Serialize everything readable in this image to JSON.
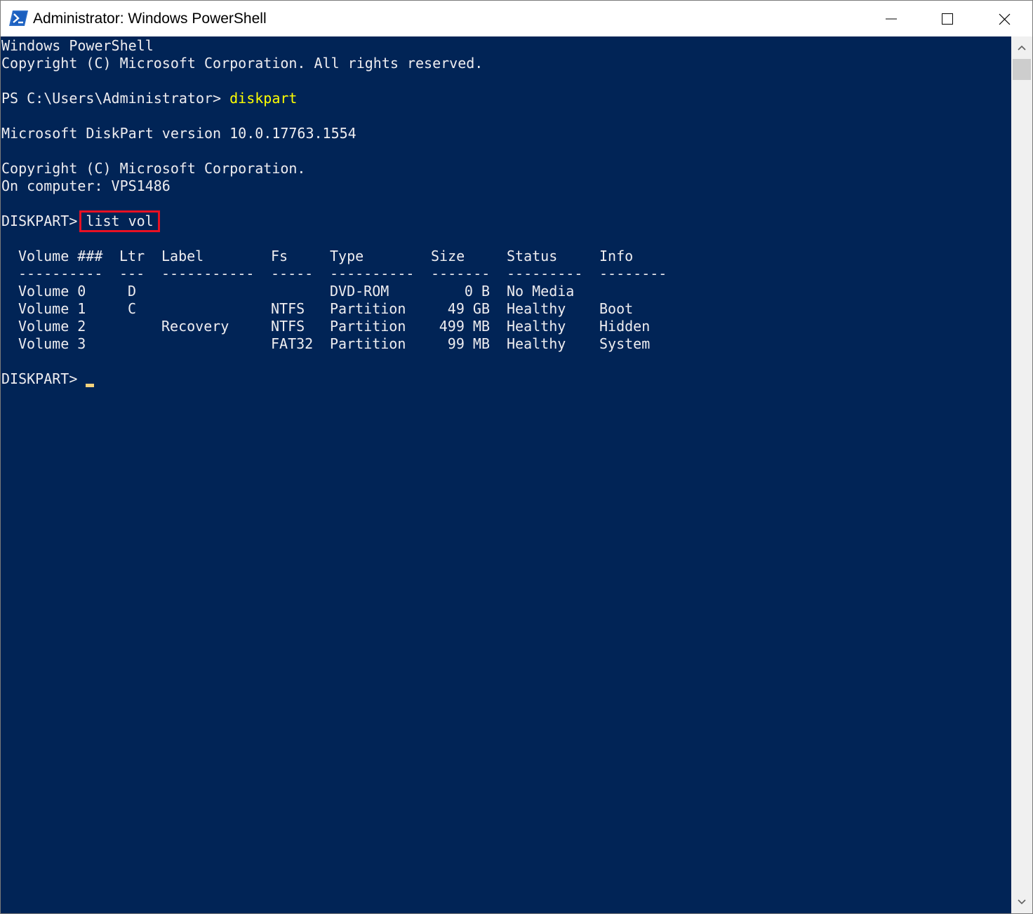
{
  "window": {
    "title": "Administrator: Windows PowerShell",
    "icon": "powershell-icon",
    "controls": {
      "minimize": "minimize-icon",
      "maximize": "maximize-icon",
      "close": "close-icon"
    }
  },
  "console": {
    "colors": {
      "background": "#012456",
      "text": "#eeedf0",
      "command": "#ffff00",
      "highlight_box": "#e81123",
      "cursor": "#f5d37d"
    },
    "banner_1": "Windows PowerShell",
    "banner_2": "Copyright (C) Microsoft Corporation. All rights reserved.",
    "ps_prompt": "PS C:\\Users\\Administrator> ",
    "ps_command": "diskpart",
    "diskpart_version": "Microsoft DiskPart version 10.0.17763.1554",
    "diskpart_copyright": "Copyright (C) Microsoft Corporation.",
    "computer_line": "On computer: VPS1486",
    "diskpart_prompt": "DISKPART>",
    "diskpart_command": "list vol",
    "final_prompt": "DISKPART> ",
    "table": {
      "headers": [
        "Volume ###",
        "Ltr",
        "Label",
        "Fs",
        "Type",
        "Size",
        "Status",
        "Info"
      ],
      "separators": [
        "----------",
        "---",
        "-----------",
        "-----",
        "----------",
        "-------",
        "---------",
        "--------"
      ],
      "rows": [
        [
          "Volume 0",
          "D",
          "",
          "",
          "DVD-ROM",
          "0 B",
          "No Media",
          ""
        ],
        [
          "Volume 1",
          "C",
          "",
          "NTFS",
          "Partition",
          "49 GB",
          "Healthy",
          "Boot"
        ],
        [
          "Volume 2",
          "",
          "Recovery",
          "NTFS",
          "Partition",
          "499 MB",
          "Healthy",
          "Hidden"
        ],
        [
          "Volume 3",
          "",
          "",
          "FAT32",
          "Partition",
          "99 MB",
          "Healthy",
          "System"
        ]
      ]
    }
  }
}
